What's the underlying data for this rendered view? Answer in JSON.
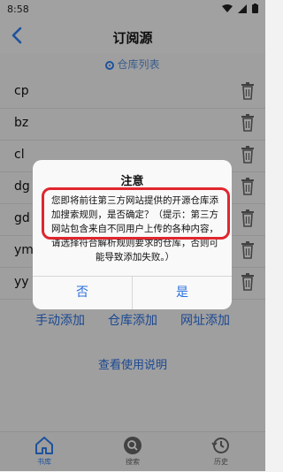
{
  "status_bar": {
    "time": "8:58"
  },
  "app_bar": {
    "title": "订阅源"
  },
  "segment": {
    "label": "仓库列表"
  },
  "repos": [
    {
      "name": "cp"
    },
    {
      "name": "bz"
    },
    {
      "name": "cl"
    },
    {
      "name": "dg"
    },
    {
      "name": "gd"
    },
    {
      "name": "ym"
    },
    {
      "name": "yy"
    }
  ],
  "actions": {
    "manual_add": "手动添加",
    "repo_add": "仓库添加",
    "url_add": "网址添加",
    "guide": "查看使用说明"
  },
  "bottom_nav": [
    {
      "label": "书库",
      "icon": "home-icon",
      "active": true
    },
    {
      "label": "搜索",
      "icon": "search-icon",
      "active": false
    },
    {
      "label": "历史",
      "icon": "history-icon",
      "active": false
    }
  ],
  "dialog": {
    "title": "注意",
    "message": "您即将前往第三方网站提供的开源仓库添加搜索规则，是否确定？（提示：第三方网站包含来自不同用户上传的各种内容，请选择符合解析规则要求的仓库，否则可能导致添加失败。）",
    "cancel_label": "否",
    "confirm_label": "是"
  },
  "colors": {
    "accent": "#2d7ff0",
    "link": "#2a6fe0",
    "highlight": "#e0262e"
  }
}
